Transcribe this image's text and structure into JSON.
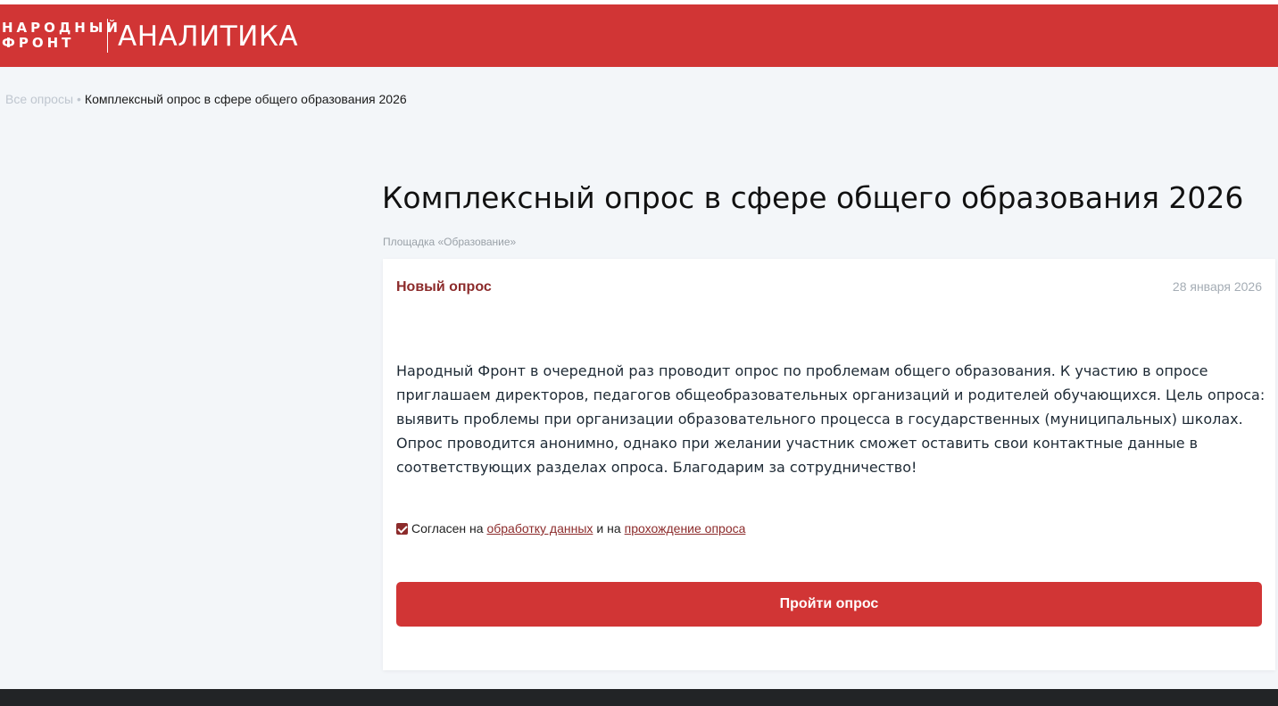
{
  "header": {
    "logo_line1": "НАРОДНЫЙ",
    "logo_line2": "ФРОНТ",
    "section_title": "АНАЛИТИКА",
    "background_color": "#d13535"
  },
  "breadcrumb": {
    "link": "Все опросы",
    "separator": "•",
    "current": "Комплексный опрос в сфере общего образования 2026"
  },
  "page": {
    "title": "Комплексный опрос в сфере общего образования 2026",
    "subtitle": "Площадка «Образование»"
  },
  "card": {
    "badge": "Новый опрос",
    "date": "28 января 2026",
    "description": "Народный Фронт в очередной раз проводит опрос по проблемам общего образования. К участию в опросе приглашаем директоров, педагогов общеобразовательных организаций и родителей обучающихся. Цель опроса: выявить проблемы при организации образовательного процесса в государственных (муниципальных) школах. Опрос проводится анонимно, однако при желании участник сможет оставить свои контактные данные в соответствующих разделах опроса. Благодарим за сотрудничество!",
    "consent": {
      "checked": true,
      "prefix": "Согласен на",
      "link1": "обработку данных",
      "middle": "и на",
      "link2": "прохождение опроса"
    },
    "button_label": "Пройти опрос"
  },
  "colors": {
    "accent": "#d13535",
    "badge": "#8c2b2b",
    "footer": "#222426"
  }
}
